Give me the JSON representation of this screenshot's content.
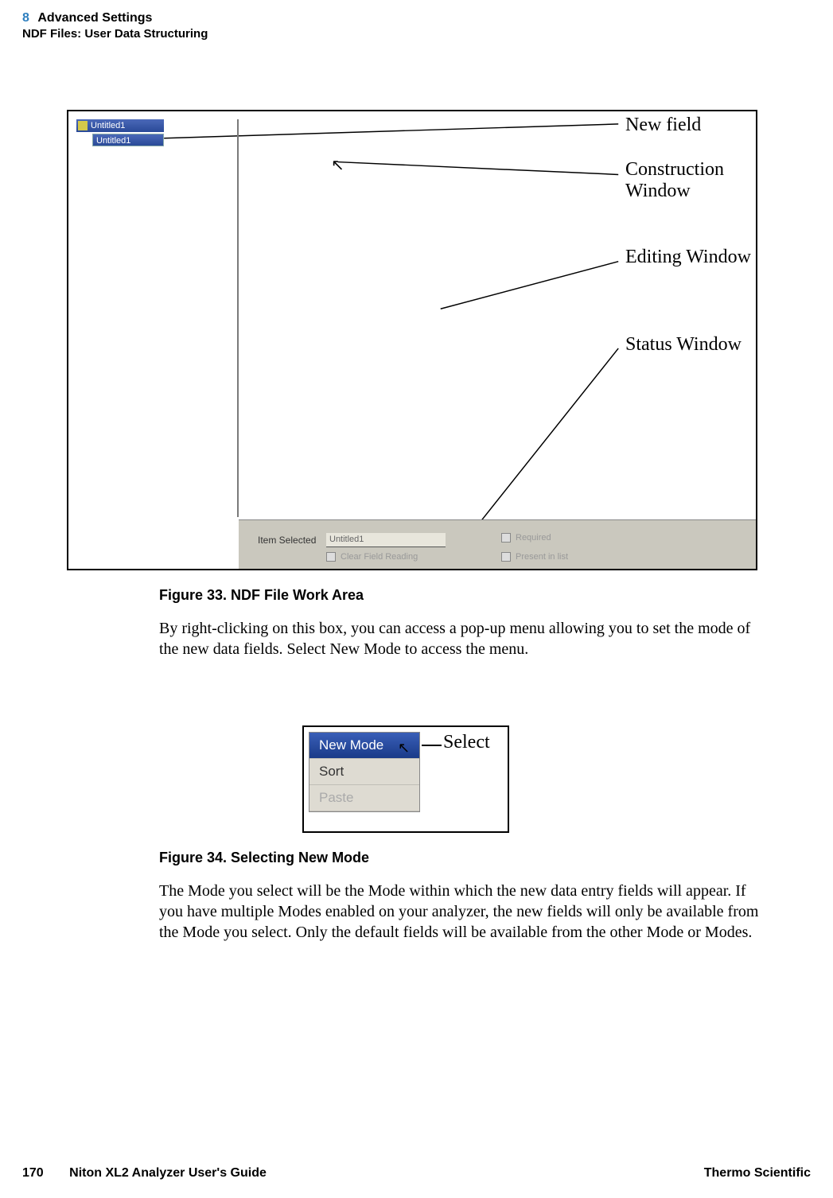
{
  "header": {
    "chapter_num": "8",
    "chapter_title": "Advanced Settings",
    "section_title": "NDF Files: User Data Structuring"
  },
  "figure33": {
    "caption": "Figure 33.   NDF File Work Area",
    "tree_item_1": "Untitled1",
    "tree_item_2": "Untitled1",
    "status_label": "Item Selected",
    "status_value": "Untitled1",
    "chk1_label": "Clear Field Reading",
    "chk2_label": "Required",
    "chk3_label": "Present in list",
    "callouts": {
      "new_field": "New field",
      "construction": "Construction Window",
      "editing": "Editing Window",
      "status": "Status Window"
    }
  },
  "paragraph1": "By right-clicking on this box, you can access a pop-up menu allowing you to set the mode of the new data fields. Select New Mode to access the menu.",
  "figure34": {
    "caption": "Figure 34.   Selecting New Mode",
    "menu": {
      "item1": "New Mode",
      "item2": "Sort",
      "item3": "Paste"
    },
    "callout": "Select"
  },
  "paragraph2": "The Mode you select will be the Mode within which the new data entry fields will appear. If you have multiple Modes enabled on your analyzer, the new fields will only be available from the Mode you select. Only the default fields will be available from the other Mode or Modes.",
  "footer": {
    "page": "170",
    "guide": "Niton XL2 Analyzer User's Guide",
    "brand": "Thermo Scientific"
  }
}
